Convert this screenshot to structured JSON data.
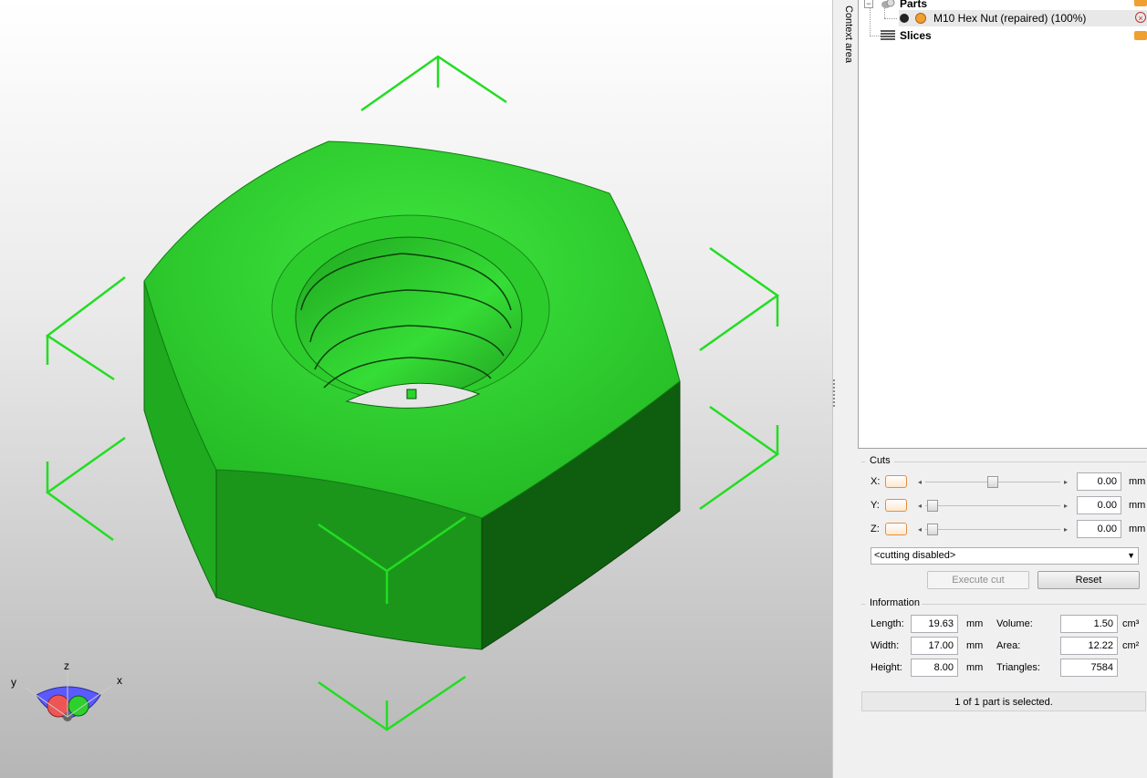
{
  "context_area_label": "Context area",
  "tree": {
    "parts_label": "Parts",
    "part_name": "M10 Hex Nut (repaired) (100%)",
    "slices_label": "Slices"
  },
  "cuts": {
    "title": "Cuts",
    "axes": [
      {
        "label": "X:",
        "value": "0.00",
        "unit": "mm",
        "position": 0.5
      },
      {
        "label": "Y:",
        "value": "0.00",
        "unit": "mm",
        "position": 0.0
      },
      {
        "label": "Z:",
        "value": "0.00",
        "unit": "mm",
        "position": 0.0
      }
    ],
    "mode": "<cutting disabled>",
    "execute_label": "Execute cut",
    "reset_label": "Reset"
  },
  "info": {
    "title": "Information",
    "length_label": "Length:",
    "length": "19.63",
    "length_unit": "mm",
    "width_label": "Width:",
    "width": "17.00",
    "width_unit": "mm",
    "height_label": "Height:",
    "height": "8.00",
    "height_unit": "mm",
    "volume_label": "Volume:",
    "volume": "1.50",
    "volume_unit": "cm³",
    "area_label": "Area:",
    "area": "12.22",
    "area_unit": "cm²",
    "triangles_label": "Triangles:",
    "triangles": "7584"
  },
  "status": "1 of 1 part is selected.",
  "axis_gizmo": {
    "x": "x",
    "y": "y",
    "z": "z"
  },
  "colors": {
    "model": "#22c322",
    "handles": "#22dd22",
    "accent": "#e09040"
  }
}
